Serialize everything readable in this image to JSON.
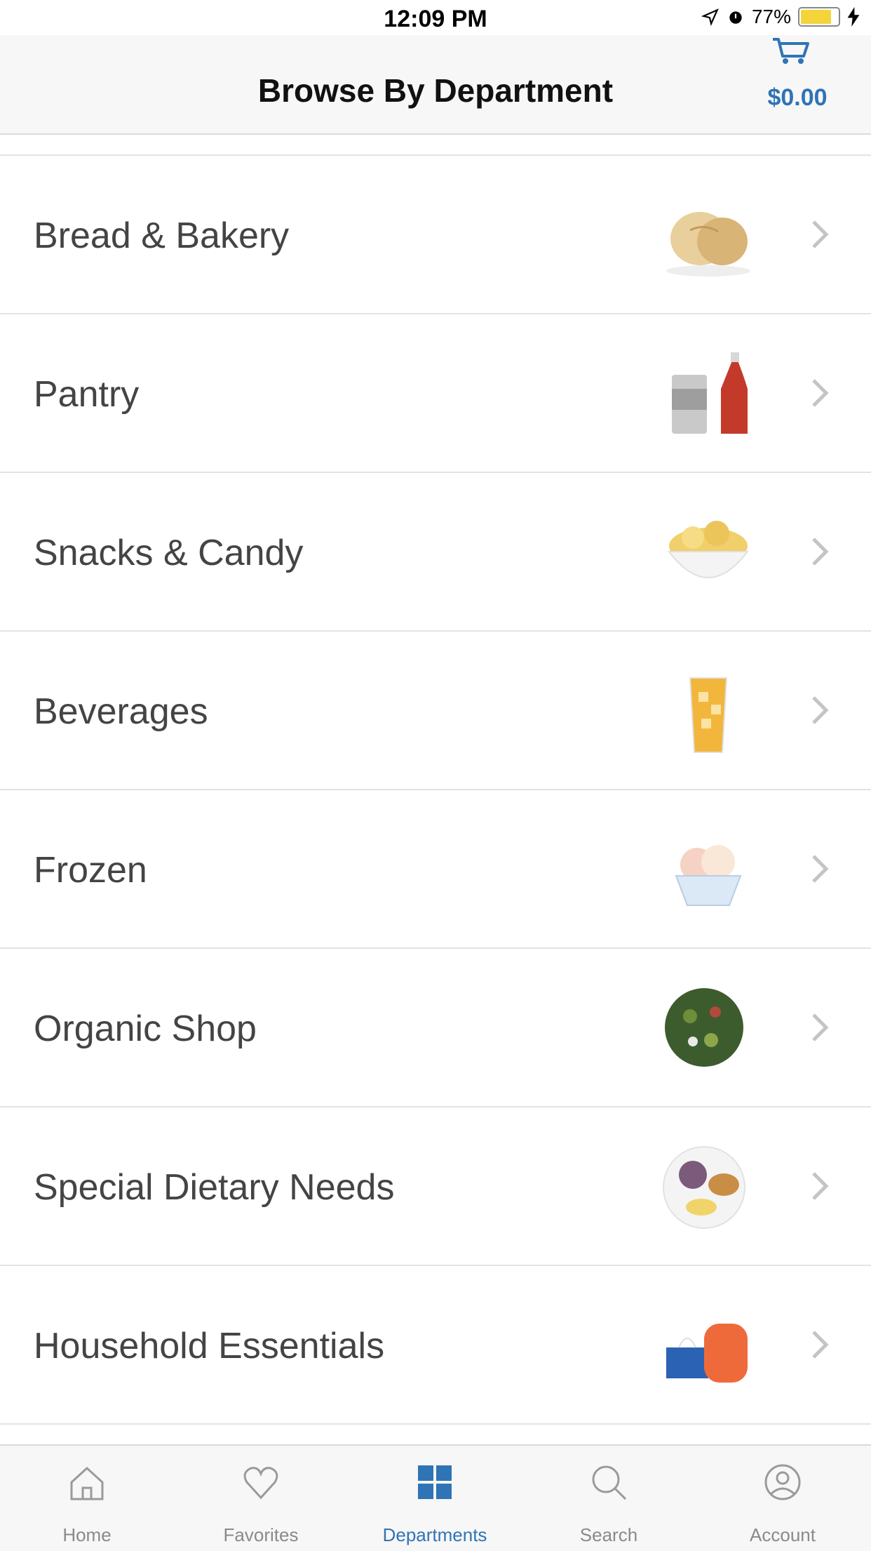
{
  "status_bar": {
    "carrier": "",
    "time": "12:09 PM",
    "battery_pct": "77%",
    "battery_level": 0.77
  },
  "header": {
    "title": "Browse By Department",
    "cart_total": "$0.00"
  },
  "departments": [
    {
      "label": "Bread & Bakery",
      "image": "bread-image"
    },
    {
      "label": "Pantry",
      "image": "pantry-cans-image"
    },
    {
      "label": "Snacks & Candy",
      "image": "chips-bowl-image"
    },
    {
      "label": "Beverages",
      "image": "iced-drink-image"
    },
    {
      "label": "Frozen",
      "image": "ice-cream-image"
    },
    {
      "label": "Organic Shop",
      "image": "salad-plate-image"
    },
    {
      "label": "Special Dietary Needs",
      "image": "meal-plate-image"
    },
    {
      "label": "Household Essentials",
      "image": "tissue-soap-image"
    }
  ],
  "tabbar": {
    "tabs": [
      {
        "label": "Home",
        "icon": "home-icon"
      },
      {
        "label": "Favorites",
        "icon": "heart-icon"
      },
      {
        "label": "Departments",
        "icon": "grid-icon",
        "active": true
      },
      {
        "label": "Search",
        "icon": "search-icon"
      },
      {
        "label": "Account",
        "icon": "account-icon"
      }
    ]
  },
  "colors": {
    "accent": "#2f74b5",
    "text": "#444444",
    "divider": "#e3e3e3"
  }
}
